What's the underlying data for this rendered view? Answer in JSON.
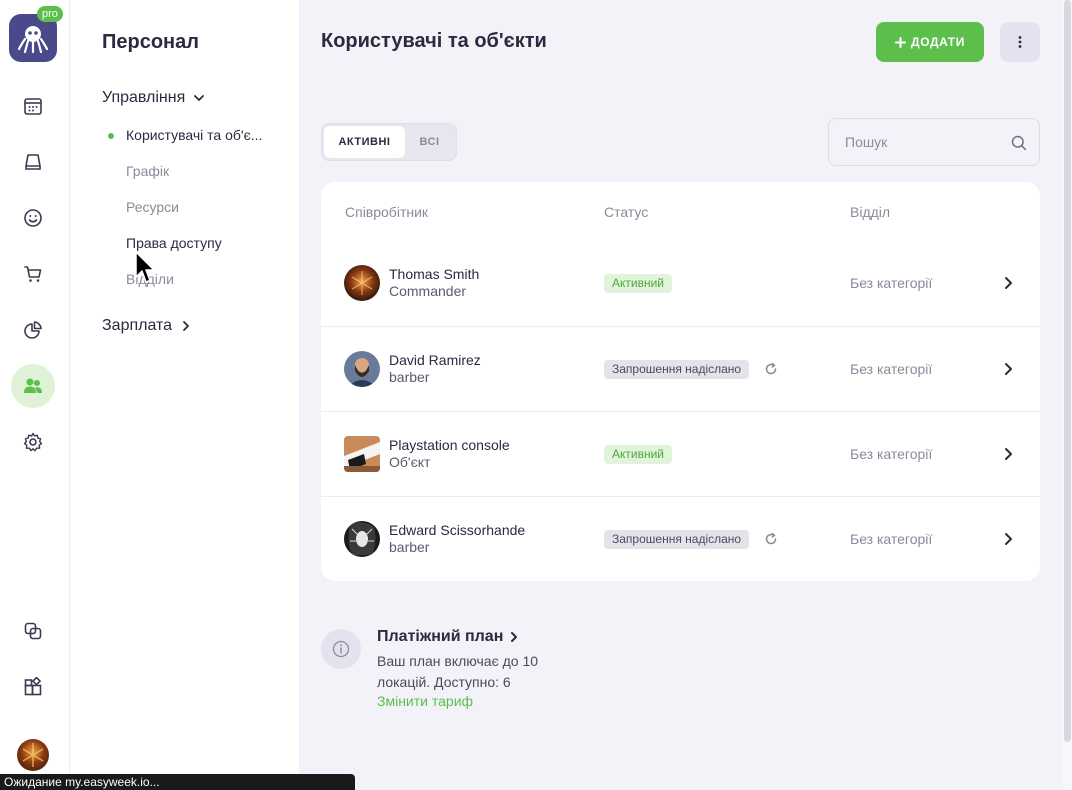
{
  "rail": {
    "logo_badge": "pro",
    "items": [
      {
        "name": "calendar-icon"
      },
      {
        "name": "inbox-icon"
      },
      {
        "name": "smiley-icon"
      },
      {
        "name": "cart-icon"
      },
      {
        "name": "pie-chart-icon"
      },
      {
        "name": "users-icon",
        "active": true
      },
      {
        "name": "gear-icon"
      },
      {
        "name": "copy-icon"
      },
      {
        "name": "apps-icon"
      }
    ]
  },
  "subnav": {
    "title": "Персонал",
    "management": "Управління",
    "items": [
      "Користувачі та об'є...",
      "Графік",
      "Ресурси",
      "Права доступу",
      "Відділи"
    ],
    "salary": "Зарплата"
  },
  "main": {
    "title": "Користувачі та об'єкти",
    "add_label": "ДОДАТИ",
    "tabs": [
      "АКТИВНІ",
      "ВСІ"
    ],
    "search_placeholder": "Пошук",
    "columns": [
      "Співробітник",
      "Статус",
      "Відділ"
    ],
    "rows": [
      {
        "name": "Thomas Smith",
        "role": "Commander",
        "status": "Активний",
        "status_type": "active",
        "dept": "Без категорії"
      },
      {
        "name": "David Ramirez",
        "role": "barber",
        "status": "Запрошення надіслано",
        "status_type": "invited",
        "dept": "Без категорії"
      },
      {
        "name": "Playstation console",
        "role": "Об'єкт",
        "status": "Активний",
        "status_type": "active",
        "dept": "Без категорії"
      },
      {
        "name": "Edward Scissorhande",
        "role": "barber",
        "status": "Запрошення надіслано",
        "status_type": "invited",
        "dept": "Без категорії"
      }
    ],
    "plan": {
      "title": "Платіжний план",
      "text": "Ваш план включає до 10 локацій. Доступно: 6",
      "link": "Змінити тариф"
    }
  },
  "statusbar": "Ожидание my.easyweek.io...",
  "colors": {
    "accent": "#5cbf4b",
    "text": "#2a2a40",
    "muted": "#8a8a9a",
    "bg": "#f2f2f8"
  }
}
